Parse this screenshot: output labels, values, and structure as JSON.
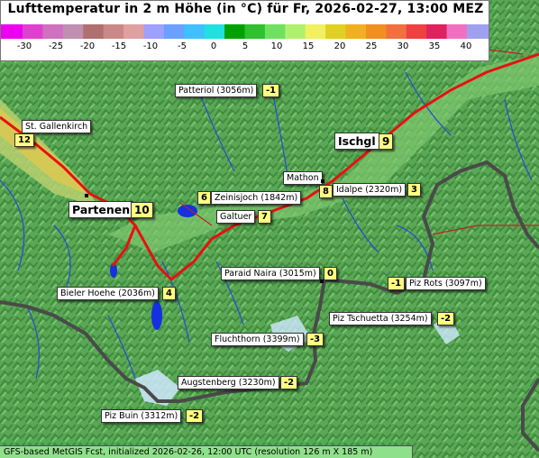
{
  "title": "Lufttemperatur in 2 m Höhe (in °C) für Fr, 2026-02-27, 13:00 MEZ",
  "legend": {
    "ticks": [
      "-30",
      "-25",
      "-20",
      "-15",
      "-10",
      "-5",
      "0",
      "5",
      "10",
      "15",
      "20",
      "25",
      "30",
      "35",
      "40"
    ],
    "colors": [
      "#ee00ee",
      "#e040d0",
      "#d070c0",
      "#c090b0",
      "#b07070",
      "#cc8888",
      "#e0a0a0",
      "#a0a0ff",
      "#6aa0ff",
      "#40c0ff",
      "#20e0e0",
      "#00a000",
      "#30c030",
      "#70e060",
      "#b0f070",
      "#f0f060",
      "#e0d020",
      "#f0b020",
      "#f09020",
      "#f07040",
      "#f04040",
      "#e02060",
      "#f070c0",
      "#a0a0f0"
    ]
  },
  "locations": [
    {
      "name": "Patteriol (3056m)",
      "value": "-1"
    },
    {
      "name": "St. Gallenkirch",
      "value": "12"
    },
    {
      "name": "Ischgl",
      "value": "9"
    },
    {
      "name": "Mathon",
      "value": "8"
    },
    {
      "name": "Idalpe (2320m)",
      "value": "3"
    },
    {
      "name": "Zeinisjoch (1842m)",
      "value": "6"
    },
    {
      "name": "Partenen",
      "value": "10"
    },
    {
      "name": "Galtuer",
      "value": "7"
    },
    {
      "name": "Paraid Naira (3015m)",
      "value": "0"
    },
    {
      "name": "Piz Rots (3097m)",
      "value": "-1"
    },
    {
      "name": "Bieler Hoehe (2036m)",
      "value": "4"
    },
    {
      "name": "Piz Tschuetta (3254m)",
      "value": "-2"
    },
    {
      "name": "Fluchthorn (3399m)",
      "value": "-3"
    },
    {
      "name": "Augstenberg (3230m)",
      "value": "-2"
    },
    {
      "name": "Piz Buin (3312m)",
      "value": "-2"
    }
  ],
  "footer": "GFS-based MetGIS Fcst, initialized 2026-02-26, 12:00 UTC  (resolution 126 m X 185 m)"
}
